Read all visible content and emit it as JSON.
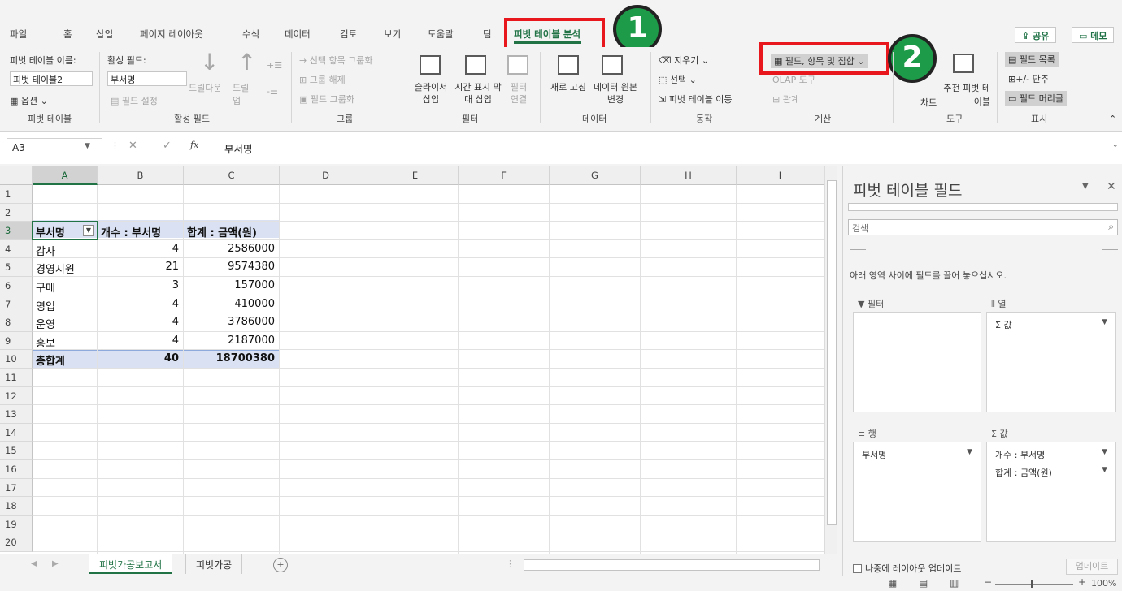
{
  "ribbon_tabs": [
    "파일",
    "홈",
    "삽입",
    "페이지 레이아웃",
    "수식",
    "데이터",
    "검토",
    "보기",
    "도움말",
    "팀",
    "피벗 테이블 분석"
  ],
  "share_label": "공유",
  "memo_label": "메모",
  "annotations": {
    "badge1": "1",
    "badge2": "2"
  },
  "ribbon": {
    "pivot_name_label": "피벗 테이블 이름:",
    "pivot_name_value": "피벗 테이블2",
    "options_label": "옵션",
    "group_pivot": "피벗 테이블",
    "active_field_label": "활성 필드:",
    "active_field_value": "부서명",
    "field_settings": "필드 설정",
    "drilldown": "드릴다운",
    "drillup": "드릴 업",
    "group_active": "활성 필드",
    "group_selection": "→ 선택 항목 그룹화",
    "ungroup": "그룹 해제",
    "group_field": "필드 그룹화",
    "group_group": "그룹",
    "slicer": "슬라이서 삽입",
    "timeline": "시간 표시 막대 삽입",
    "filter_conn": "필터 연결",
    "group_filter": "필터",
    "refresh": "새로 고침",
    "change_source": "데이터 원본 변경",
    "group_data": "데이터",
    "clear": "지우기",
    "select": "선택",
    "move_pivot": "피벗 테이블 이동",
    "group_action": "동작",
    "fields_items_sets": "필드, 항목 및 집합",
    "olap_tools": "OLAP 도구",
    "relationships": "관계",
    "group_calc": "계산",
    "pivot_chart": "차트",
    "recommended": "추천 피벗 테이블",
    "group_tools": "도구",
    "field_list": "필드 목록",
    "buttons": "+/- 단추",
    "field_headers": "필드 머리글",
    "group_show": "표시"
  },
  "formula_bar": {
    "name_box": "A3",
    "fx": "fx",
    "content": "부서명"
  },
  "columns": [
    "A",
    "B",
    "C",
    "D",
    "E",
    "F",
    "G",
    "H",
    "I"
  ],
  "rows": [
    "1",
    "2",
    "3",
    "4",
    "5",
    "6",
    "7",
    "8",
    "9",
    "10",
    "11",
    "12",
    "13",
    "14",
    "15",
    "16",
    "17",
    "18",
    "19",
    "20"
  ],
  "pivot": {
    "headers": [
      "부서명",
      "개수 : 부서명",
      "합계 : 금액(원)"
    ],
    "rows": [
      [
        "감사",
        "4",
        "2586000"
      ],
      [
        "경영지원",
        "21",
        "9574380"
      ],
      [
        "구매",
        "3",
        "157000"
      ],
      [
        "영업",
        "4",
        "410000"
      ],
      [
        "운영",
        "4",
        "3786000"
      ],
      [
        "홍보",
        "4",
        "2187000"
      ]
    ],
    "total": [
      "총합계",
      "40",
      "18700380"
    ]
  },
  "sheet_tabs": [
    "피벗가공보고서",
    "피벗가공"
  ],
  "pane": {
    "title": "피벗 테이블 필드",
    "search_placeholder": "검색",
    "hint": "아래 영역 사이에 필드를 끌어 놓으십시오.",
    "filter_label": "필터",
    "columns_label": "열",
    "rows_label": "행",
    "values_label": "값",
    "columns_items": [
      "Σ 값"
    ],
    "rows_items": [
      "부서명"
    ],
    "values_items": [
      "개수 : 부서명",
      "합계 : 금액(원)"
    ],
    "defer_label": "나중에 레이아웃 업데이트",
    "update_label": "업데이트"
  },
  "status": {
    "zoom": "100%"
  },
  "colors": {
    "accent": "#217346",
    "highlight": "#e8161d",
    "badge": "#1e9b48",
    "pivot_band": "#d9e1f2"
  }
}
